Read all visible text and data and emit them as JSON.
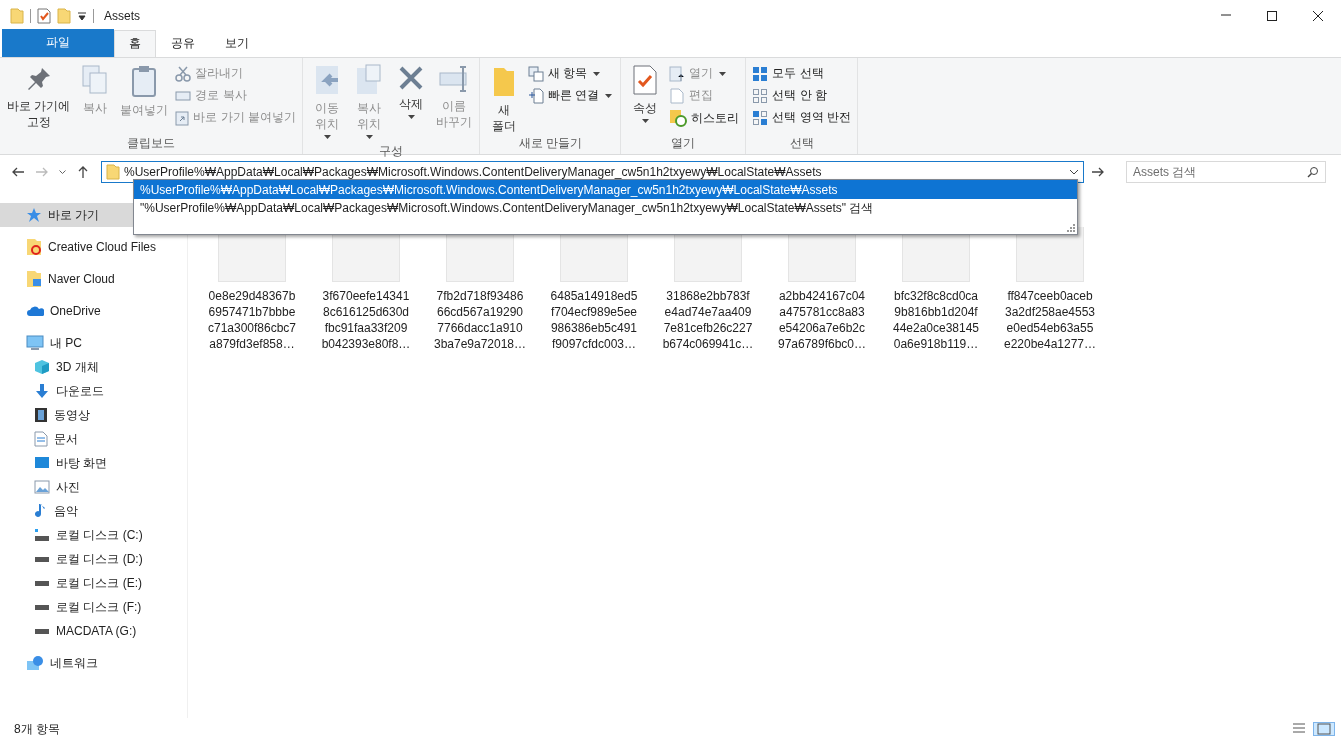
{
  "window": {
    "title": "Assets"
  },
  "ribbon_tabs": [
    {
      "label": "파일",
      "kind": "file",
      "selected": false
    },
    {
      "label": "홈",
      "kind": "tab",
      "selected": true
    },
    {
      "label": "공유",
      "kind": "tab",
      "selected": false
    },
    {
      "label": "보기",
      "kind": "tab",
      "selected": false
    }
  ],
  "ribbon_groups": [
    {
      "label": "클립보드",
      "items": [
        {
          "kind": "large",
          "label": "바로 가기에\n고정",
          "disabled": false,
          "dropdown": false
        },
        {
          "kind": "large",
          "label": "복사",
          "disabled": true,
          "dropdown": false
        },
        {
          "kind": "large",
          "label": "붙여넣기",
          "disabled": true,
          "dropdown": false
        },
        {
          "kind": "small",
          "label": "잘라내기",
          "disabled": true,
          "dropdown": false
        },
        {
          "kind": "small",
          "label": "경로 복사",
          "disabled": true,
          "dropdown": false
        },
        {
          "kind": "small",
          "label": "바로 가기 붙여넣기",
          "disabled": true,
          "dropdown": false
        }
      ]
    },
    {
      "label": "구성",
      "items": [
        {
          "kind": "large",
          "label": "이동\n위치",
          "disabled": true,
          "dropdown": true
        },
        {
          "kind": "large",
          "label": "복사\n위치",
          "disabled": true,
          "dropdown": true
        },
        {
          "kind": "large",
          "label": "삭제",
          "disabled": false,
          "dropdown": true
        },
        {
          "kind": "large",
          "label": "이름\n바꾸기",
          "disabled": true,
          "dropdown": false
        }
      ]
    },
    {
      "label": "새로 만들기",
      "items": [
        {
          "kind": "large",
          "label": "새\n폴더",
          "disabled": false,
          "dropdown": false
        },
        {
          "kind": "small",
          "label": "새 항목",
          "disabled": false,
          "dropdown": true
        },
        {
          "kind": "small",
          "label": "빠른 연결",
          "disabled": false,
          "dropdown": true
        }
      ]
    },
    {
      "label": "열기",
      "items": [
        {
          "kind": "large",
          "label": "속성",
          "disabled": false,
          "dropdown": true
        },
        {
          "kind": "small",
          "label": "열기",
          "disabled": true,
          "dropdown": true
        },
        {
          "kind": "small",
          "label": "편집",
          "disabled": true,
          "dropdown": false
        },
        {
          "kind": "small",
          "label": "히스토리",
          "disabled": false,
          "dropdown": false
        }
      ]
    },
    {
      "label": "선택",
      "items": [
        {
          "kind": "small",
          "label": "모두 선택",
          "disabled": false,
          "dropdown": false
        },
        {
          "kind": "small",
          "label": "선택 안 함",
          "disabled": false,
          "dropdown": false
        },
        {
          "kind": "small",
          "label": "선택 영역 반전",
          "disabled": false,
          "dropdown": false
        }
      ]
    }
  ],
  "address": {
    "value": "%UserProfile%₩AppData₩Local₩Packages₩Microsoft.Windows.ContentDeliveryManager_cw5n1h2txyewy₩LocalState₩Assets"
  },
  "search": {
    "placeholder": "Assets 검색"
  },
  "suggestions": [
    {
      "text": "%UserProfile%₩AppData₩Local₩Packages₩Microsoft.Windows.ContentDeliveryManager_cw5n1h2txyewy₩LocalState₩Assets",
      "selected": true
    },
    {
      "text": "\"%UserProfile%₩AppData₩Local₩Packages₩Microsoft.Windows.ContentDeliveryManager_cw5n1h2txyewy₩LocalState₩Assets\" 검색",
      "selected": false
    }
  ],
  "sidebar": {
    "items": [
      {
        "label": "바로 가기",
        "selected": true
      },
      {
        "label": "Creative Cloud Files",
        "selected": false
      },
      {
        "label": "Naver Cloud",
        "selected": false
      },
      {
        "label": "OneDrive",
        "selected": false
      },
      {
        "label": "내 PC",
        "selected": false,
        "children": [
          {
            "label": "3D 개체",
            "selected": false
          },
          {
            "label": "다운로드",
            "selected": false
          },
          {
            "label": "동영상",
            "selected": false
          },
          {
            "label": "문서",
            "selected": false
          },
          {
            "label": "바탕 화면",
            "selected": false
          },
          {
            "label": "사진",
            "selected": false
          },
          {
            "label": "음악",
            "selected": false
          },
          {
            "label": "로컬 디스크 (C:)",
            "selected": false
          },
          {
            "label": "로컬 디스크 (D:)",
            "selected": false
          },
          {
            "label": "로컬 디스크 (E:)",
            "selected": false
          },
          {
            "label": "로컬 디스크 (F:)",
            "selected": false
          },
          {
            "label": "MACDATA (G:)",
            "selected": false
          }
        ]
      },
      {
        "label": "네트워크",
        "selected": false
      }
    ]
  },
  "files": [
    {
      "name_lines": [
        "0e8e29d48367b",
        "6957471b7bbbe",
        "c71a300f86cbc7",
        "a879fd3ef858…"
      ]
    },
    {
      "name_lines": [
        "3f670eefe14341",
        "8c616125d630d",
        "fbc91faa33f209",
        "b042393e80f8…"
      ]
    },
    {
      "name_lines": [
        "7fb2d718f93486",
        "66cd567a19290",
        "7766dacc1a910",
        "3ba7e9a72018…"
      ]
    },
    {
      "name_lines": [
        "6485a14918ed5",
        "f704ecf989e5ee",
        "986386eb5c491",
        "f9097cfdc003…"
      ]
    },
    {
      "name_lines": [
        "31868e2bb783f",
        "e4ad74e7aa409",
        "7e81cefb26c227",
        "b674c069941c…"
      ]
    },
    {
      "name_lines": [
        "a2bb424167c04",
        "a475781cc8a83",
        "e54206a7e6b2c",
        "97a6789f6bc0…"
      ]
    },
    {
      "name_lines": [
        "bfc32f8c8cd0ca",
        "9b816bb1d204f",
        "44e2a0ce38145",
        "0a6e918b119…"
      ]
    },
    {
      "name_lines": [
        "ff847ceeb0aceb",
        "3a2df258ae4553",
        "e0ed54eb63a55",
        "e220be4a1277…"
      ]
    }
  ],
  "status_bar": {
    "count": "8개 항목"
  }
}
